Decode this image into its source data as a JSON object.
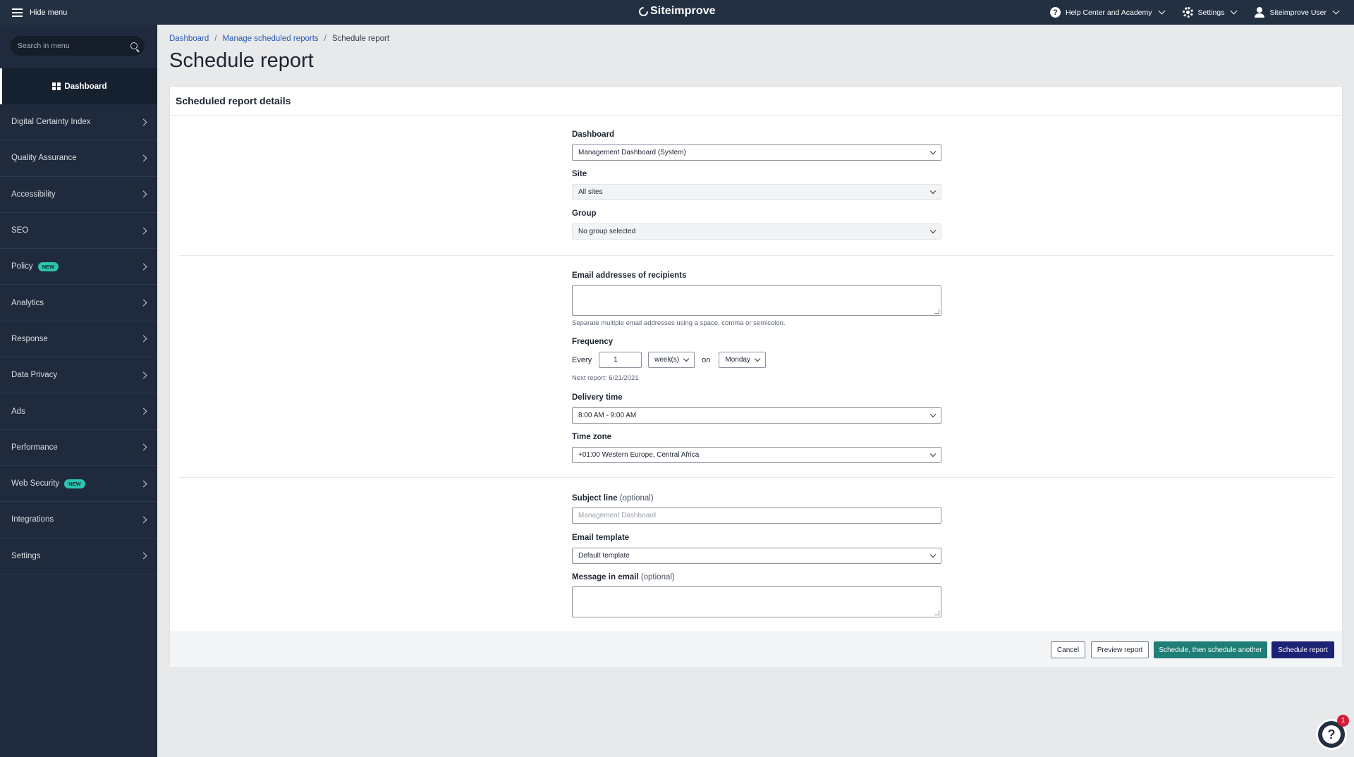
{
  "topbar": {
    "hide_menu": "Hide menu",
    "brand": "Siteimprove",
    "help": "Help Center and Academy",
    "settings": "Settings",
    "user": "Siteimprove User"
  },
  "sidebar": {
    "search_placeholder": "Search in menu",
    "dashboard": "Dashboard",
    "items": [
      {
        "label": "Digital Certainty Index"
      },
      {
        "label": "Quality Assurance"
      },
      {
        "label": "Accessibility"
      },
      {
        "label": "SEO"
      },
      {
        "label": "Policy",
        "badge": "NEW"
      },
      {
        "label": "Analytics"
      },
      {
        "label": "Response"
      },
      {
        "label": "Data Privacy"
      },
      {
        "label": "Ads"
      },
      {
        "label": "Performance"
      },
      {
        "label": "Web Security",
        "badge": "NEW"
      },
      {
        "label": "Integrations"
      },
      {
        "label": "Settings"
      }
    ]
  },
  "breadcrumb": {
    "items": [
      "Dashboard",
      "Manage scheduled reports"
    ],
    "current": "Schedule report",
    "separator": "/"
  },
  "page": {
    "title": "Schedule report",
    "card_title": "Scheduled report details"
  },
  "form": {
    "dashboard_label": "Dashboard",
    "dashboard_value": "Management Dashboard (System)",
    "site_label": "Site",
    "site_value": "All sites",
    "group_label": "Group",
    "group_value": "No group selected",
    "emails_label": "Email addresses of recipients",
    "emails_hint": "Separate multiple email addresses using a space, comma or semicolon.",
    "frequency_label": "Frequency",
    "every": "Every",
    "every_value": "1",
    "unit_value": "week(s)",
    "on": "on",
    "day_value": "Monday",
    "next_report": "Next report: 6/21/2021",
    "delivery_label": "Delivery time",
    "delivery_value": "8:00 AM - 9:00 AM",
    "timezone_label": "Time zone",
    "timezone_value": "+01:00 Western Europe, Central Africa",
    "subject_label": "Subject line",
    "subject_opt": "(optional)",
    "subject_placeholder": "Management Dashboard",
    "template_label": "Email template",
    "template_value": "Default template",
    "message_label": "Message in email",
    "message_opt": "(optional)"
  },
  "footer": {
    "cancel": "Cancel",
    "preview": "Preview report",
    "schedule_another": "Schedule, then schedule another",
    "schedule": "Schedule report"
  },
  "fab": {
    "badge": "1",
    "glyph": "?"
  }
}
